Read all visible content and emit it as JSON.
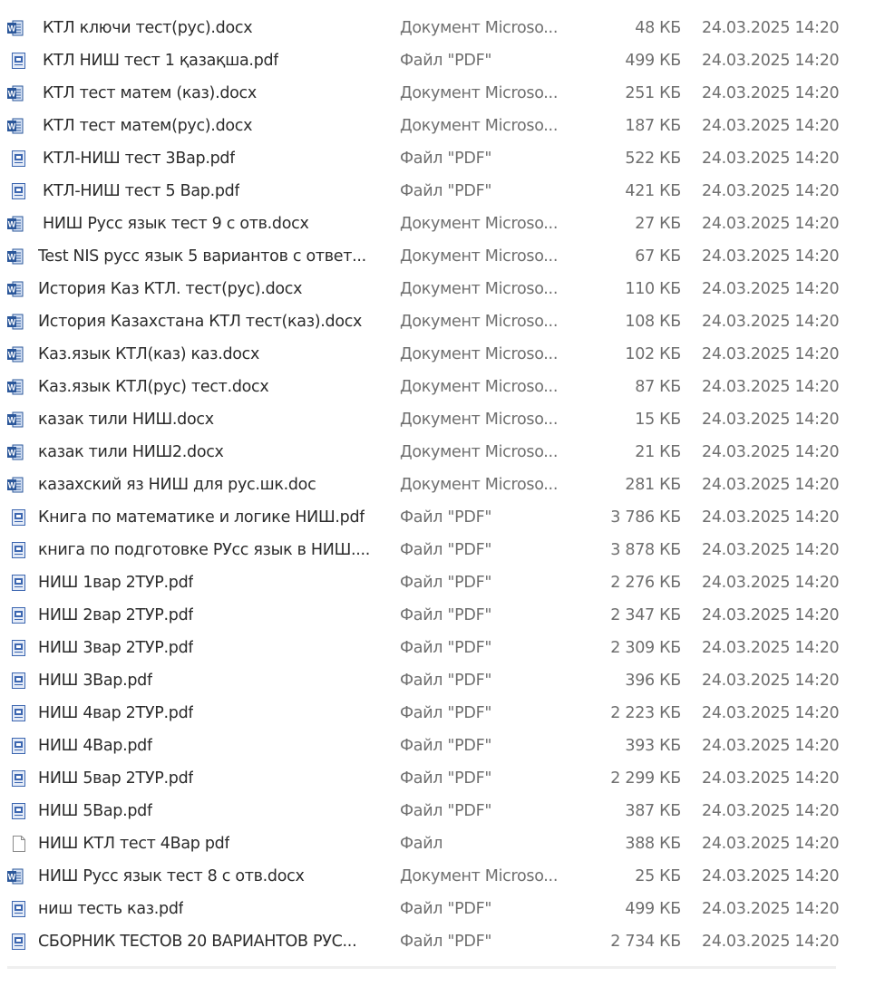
{
  "icons": {
    "word": "word-doc-icon",
    "pdf": "pdf-file-icon",
    "blank": "blank-file-icon",
    "word_colors": {
      "blue": "#2b579a",
      "light": "#d7e3f5"
    },
    "pdf_colors": {
      "blue": "#3c66b0",
      "light": "#e4ebf7"
    }
  },
  "files": [
    {
      "name": "КТЛ ключи тест(рус).docx",
      "type": "Документ Microso...",
      "size": "48 КБ",
      "date": "24.03.2025 14:20",
      "icon": "word"
    },
    {
      "name": "КТЛ НИШ тест 1 қазақша.pdf",
      "type": "Файл \"PDF\"",
      "size": "499 КБ",
      "date": "24.03.2025 14:20",
      "icon": "pdf"
    },
    {
      "name": "КТЛ тест матем (каз).docx",
      "type": "Документ Microso...",
      "size": "251 КБ",
      "date": "24.03.2025 14:20",
      "icon": "word"
    },
    {
      "name": "КТЛ тест матем(рус).docx",
      "type": "Документ Microso...",
      "size": "187 КБ",
      "date": "24.03.2025 14:20",
      "icon": "word"
    },
    {
      "name": "КТЛ-НИШ тест 3Вар.pdf",
      "type": "Файл \"PDF\"",
      "size": "522 КБ",
      "date": "24.03.2025 14:20",
      "icon": "pdf"
    },
    {
      "name": "КТЛ-НИШ тест 5 Вар.pdf",
      "type": "Файл \"PDF\"",
      "size": "421 КБ",
      "date": "24.03.2025 14:20",
      "icon": "pdf"
    },
    {
      "name": "НИШ Русс язык тест 9 с отв.docx",
      "type": "Документ Microso...",
      "size": "27 КБ",
      "date": "24.03.2025 14:20",
      "icon": "word"
    },
    {
      "name": "Test NIS русс язык 5 вариантов с ответ...",
      "type": "Документ Microso...",
      "size": "67 КБ",
      "date": "24.03.2025 14:20",
      "icon": "word"
    },
    {
      "name": "История Каз КТЛ. тест(рус).docx",
      "type": "Документ Microso...",
      "size": "110 КБ",
      "date": "24.03.2025 14:20",
      "icon": "word"
    },
    {
      "name": "История Казахстана КТЛ тест(каз).docx",
      "type": "Документ Microso...",
      "size": "108 КБ",
      "date": "24.03.2025 14:20",
      "icon": "word"
    },
    {
      "name": "Каз.язык КТЛ(каз) каз.docx",
      "type": "Документ Microso...",
      "size": "102 КБ",
      "date": "24.03.2025 14:20",
      "icon": "word"
    },
    {
      "name": "Каз.язык КТЛ(рус) тест.docx",
      "type": "Документ Microso...",
      "size": "87 КБ",
      "date": "24.03.2025 14:20",
      "icon": "word"
    },
    {
      "name": "казак тили НИШ.docx",
      "type": "Документ Microso...",
      "size": "15 КБ",
      "date": "24.03.2025 14:20",
      "icon": "word"
    },
    {
      "name": "казак тили НИШ2.docx",
      "type": "Документ Microso...",
      "size": "21 КБ",
      "date": "24.03.2025 14:20",
      "icon": "word"
    },
    {
      "name": "казахский яз НИШ для рус.шк.doc",
      "type": "Документ Microso...",
      "size": "281 КБ",
      "date": "24.03.2025 14:20",
      "icon": "word"
    },
    {
      "name": "Книга по математике и логике НИШ.pdf",
      "type": "Файл \"PDF\"",
      "size": "3 786 КБ",
      "date": "24.03.2025 14:20",
      "icon": "pdf"
    },
    {
      "name": "книга по подготовке РУсс язык в НИШ....",
      "type": "Файл \"PDF\"",
      "size": "3 878 КБ",
      "date": "24.03.2025 14:20",
      "icon": "pdf"
    },
    {
      "name": "НИШ 1вар 2ТУР.pdf",
      "type": "Файл \"PDF\"",
      "size": "2 276 КБ",
      "date": "24.03.2025 14:20",
      "icon": "pdf"
    },
    {
      "name": "НИШ 2вар 2ТУР.pdf",
      "type": "Файл \"PDF\"",
      "size": "2 347 КБ",
      "date": "24.03.2025 14:20",
      "icon": "pdf"
    },
    {
      "name": "НИШ 3вар 2ТУР.pdf",
      "type": "Файл \"PDF\"",
      "size": "2 309 КБ",
      "date": "24.03.2025 14:20",
      "icon": "pdf"
    },
    {
      "name": "НИШ 3Вар.pdf",
      "type": "Файл \"PDF\"",
      "size": "396 КБ",
      "date": "24.03.2025 14:20",
      "icon": "pdf"
    },
    {
      "name": "НИШ 4вар 2ТУР.pdf",
      "type": "Файл \"PDF\"",
      "size": "2 223 КБ",
      "date": "24.03.2025 14:20",
      "icon": "pdf"
    },
    {
      "name": "НИШ 4Вар.pdf",
      "type": "Файл \"PDF\"",
      "size": "393 КБ",
      "date": "24.03.2025 14:20",
      "icon": "pdf"
    },
    {
      "name": "НИШ 5вар 2ТУР.pdf",
      "type": "Файл \"PDF\"",
      "size": "2 299 КБ",
      "date": "24.03.2025 14:20",
      "icon": "pdf"
    },
    {
      "name": "НИШ 5Вар.pdf",
      "type": "Файл \"PDF\"",
      "size": "387 КБ",
      "date": "24.03.2025 14:20",
      "icon": "pdf"
    },
    {
      "name": "НИШ КТЛ тест 4Вар pdf",
      "type": "Файл",
      "size": "388 КБ",
      "date": "24.03.2025 14:20",
      "icon": "blank"
    },
    {
      "name": "НИШ Русс язык тест 8 с отв.docx",
      "type": "Документ Microso...",
      "size": "25 КБ",
      "date": "24.03.2025 14:20",
      "icon": "word"
    },
    {
      "name": "ниш тесть каз.pdf",
      "type": "Файл \"PDF\"",
      "size": "499 КБ",
      "date": "24.03.2025 14:20",
      "icon": "pdf"
    },
    {
      "name": "СБОРНИК ТЕСТОВ 20 ВАРИАНТОВ РУС...",
      "type": "Файл \"PDF\"",
      "size": "2 734 КБ",
      "date": "24.03.2025 14:20",
      "icon": "pdf"
    }
  ]
}
